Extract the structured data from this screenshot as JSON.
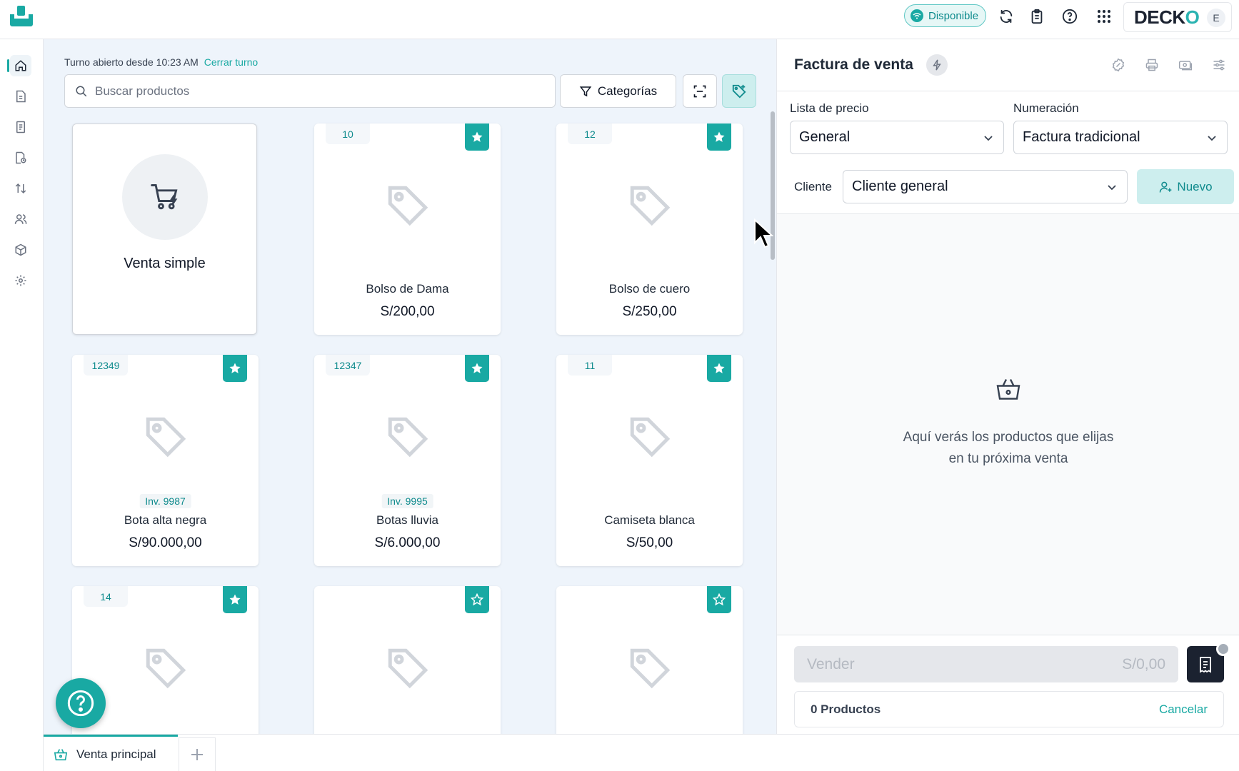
{
  "topbar": {
    "status_label": "Disponible",
    "brand_prefix": "DECK",
    "brand_o": "O",
    "avatar_initial": "E",
    "accent_color": "#19a9a3"
  },
  "sidebar": {
    "items": [
      "home-icon",
      "document-icon",
      "receipt-icon",
      "file-clock-icon",
      "transfer-icon",
      "users-icon",
      "box-icon",
      "gear-icon"
    ]
  },
  "main": {
    "shift_text": "Turno abierto desde 10:23 AM",
    "shift_link": "Cerrar turno",
    "search_placeholder": "Buscar productos",
    "categories_label": "Categorías",
    "simple_sale_label": "Venta simple",
    "products": [
      {
        "code": "10",
        "name": "Bolso de Dama",
        "price": "S/200,00",
        "inv": ""
      },
      {
        "code": "12",
        "name": "Bolso de cuero",
        "price": "S/250,00",
        "inv": ""
      },
      {
        "code": "12349",
        "name": "Bota alta negra",
        "price": "S/90.000,00",
        "inv": "Inv. 9987"
      },
      {
        "code": "12347",
        "name": "Botas lluvia",
        "price": "S/6.000,00",
        "inv": "Inv. 9995"
      },
      {
        "code": "11",
        "name": "Camiseta blanca",
        "price": "S/50,00",
        "inv": ""
      },
      {
        "code": "14",
        "name": "",
        "price": "",
        "inv": ""
      },
      {
        "code": "",
        "name": "",
        "price": "",
        "inv": ""
      },
      {
        "code": "",
        "name": "",
        "price": "",
        "inv": ""
      }
    ]
  },
  "tabs": {
    "main_tab": "Venta principal"
  },
  "invoice": {
    "title": "Factura de venta",
    "price_list_label": "Lista de precio",
    "price_list_value": "General",
    "numbering_label": "Numeración",
    "numbering_value": "Factura tradicional",
    "client_label": "Cliente",
    "client_value": "Cliente general",
    "new_button": "Nuevo",
    "empty_line1": "Aquí verás los productos que elijas",
    "empty_line2": "en tu próxima venta",
    "sell_label": "Vender",
    "sell_total": "S/0,00",
    "products_count": "0 Productos",
    "cancel_label": "Cancelar"
  }
}
